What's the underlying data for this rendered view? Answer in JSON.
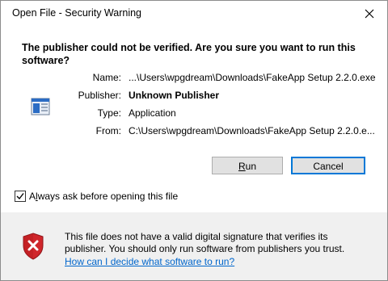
{
  "window": {
    "title": "Open File - Security Warning",
    "close_glyph": "✕"
  },
  "headline": "The publisher could not be verified.  Are you sure you want to run this software?",
  "fields": {
    "name_label": "Name:",
    "name_value": "...\\Users\\wpgdream\\Downloads\\FakeApp Setup 2.2.0.exe",
    "publisher_label": "Publisher:",
    "publisher_value": "Unknown Publisher",
    "type_label": "Type:",
    "type_value": "Application",
    "from_label": "From:",
    "from_value": "C:\\Users\\wpgdream\\Downloads\\FakeApp Setup 2.2.0.e..."
  },
  "buttons": {
    "run_label": "Run",
    "run_access_key": "R",
    "cancel_label": "Cancel"
  },
  "checkbox": {
    "label_prefix": "A",
    "label_access_key": "l",
    "label_suffix": "ways ask before opening this file",
    "checked": true
  },
  "footer": {
    "message": "This file does not have a valid digital signature that verifies its publisher.  You should only run software from publishers you trust.",
    "link": "How can I decide what software to run?"
  },
  "colors": {
    "accent": "#0078d7",
    "link": "#0066cc",
    "shield_red": "#d0262b"
  },
  "icons": {
    "app": "application-window-icon",
    "warning": "shield-x-icon",
    "check": "checkmark-icon",
    "close": "close-icon"
  }
}
